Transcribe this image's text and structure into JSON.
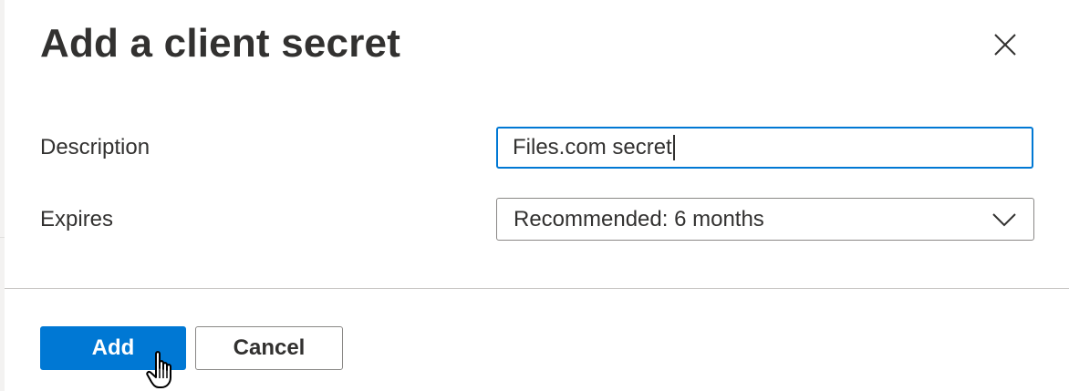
{
  "dialog": {
    "title": "Add a client secret",
    "close_icon": "close-icon"
  },
  "form": {
    "description": {
      "label": "Description",
      "value": "Files.com secret"
    },
    "expires": {
      "label": "Expires",
      "selected": "Recommended: 6 months",
      "icon": "chevron-down-icon"
    }
  },
  "footer": {
    "add_label": "Add",
    "cancel_label": "Cancel"
  },
  "pointer": {
    "icon": "hand-pointer-icon"
  },
  "colors": {
    "accent": "#0078d4",
    "text": "#323130",
    "border": "#8a8886"
  }
}
